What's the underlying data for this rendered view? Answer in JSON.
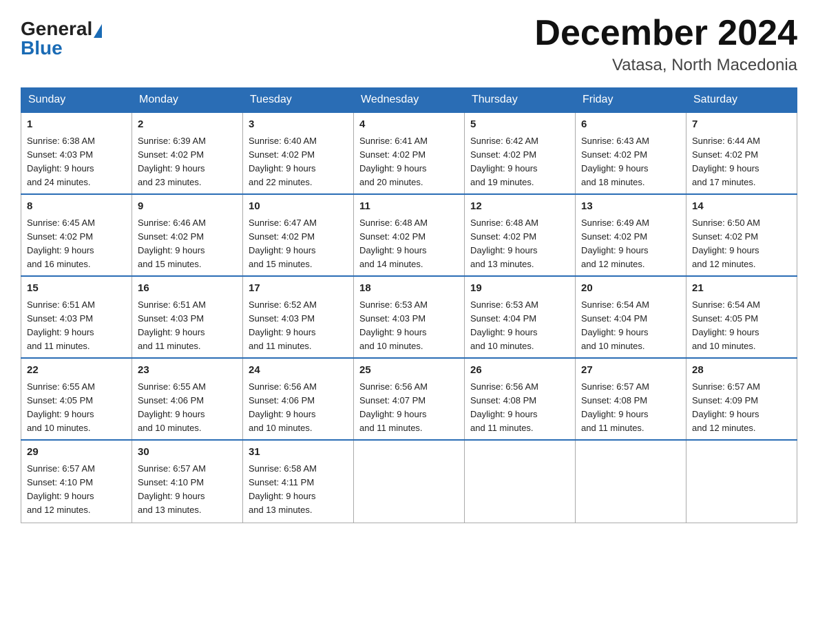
{
  "header": {
    "logo": {
      "general": "General",
      "blue": "Blue"
    },
    "title": "December 2024",
    "location": "Vatasa, North Macedonia"
  },
  "days_of_week": [
    "Sunday",
    "Monday",
    "Tuesday",
    "Wednesday",
    "Thursday",
    "Friday",
    "Saturday"
  ],
  "weeks": [
    [
      {
        "day": "1",
        "sunrise": "6:38 AM",
        "sunset": "4:03 PM",
        "daylight": "9 hours and 24 minutes."
      },
      {
        "day": "2",
        "sunrise": "6:39 AM",
        "sunset": "4:02 PM",
        "daylight": "9 hours and 23 minutes."
      },
      {
        "day": "3",
        "sunrise": "6:40 AM",
        "sunset": "4:02 PM",
        "daylight": "9 hours and 22 minutes."
      },
      {
        "day": "4",
        "sunrise": "6:41 AM",
        "sunset": "4:02 PM",
        "daylight": "9 hours and 20 minutes."
      },
      {
        "day": "5",
        "sunrise": "6:42 AM",
        "sunset": "4:02 PM",
        "daylight": "9 hours and 19 minutes."
      },
      {
        "day": "6",
        "sunrise": "6:43 AM",
        "sunset": "4:02 PM",
        "daylight": "9 hours and 18 minutes."
      },
      {
        "day": "7",
        "sunrise": "6:44 AM",
        "sunset": "4:02 PM",
        "daylight": "9 hours and 17 minutes."
      }
    ],
    [
      {
        "day": "8",
        "sunrise": "6:45 AM",
        "sunset": "4:02 PM",
        "daylight": "9 hours and 16 minutes."
      },
      {
        "day": "9",
        "sunrise": "6:46 AM",
        "sunset": "4:02 PM",
        "daylight": "9 hours and 15 minutes."
      },
      {
        "day": "10",
        "sunrise": "6:47 AM",
        "sunset": "4:02 PM",
        "daylight": "9 hours and 15 minutes."
      },
      {
        "day": "11",
        "sunrise": "6:48 AM",
        "sunset": "4:02 PM",
        "daylight": "9 hours and 14 minutes."
      },
      {
        "day": "12",
        "sunrise": "6:48 AM",
        "sunset": "4:02 PM",
        "daylight": "9 hours and 13 minutes."
      },
      {
        "day": "13",
        "sunrise": "6:49 AM",
        "sunset": "4:02 PM",
        "daylight": "9 hours and 12 minutes."
      },
      {
        "day": "14",
        "sunrise": "6:50 AM",
        "sunset": "4:02 PM",
        "daylight": "9 hours and 12 minutes."
      }
    ],
    [
      {
        "day": "15",
        "sunrise": "6:51 AM",
        "sunset": "4:03 PM",
        "daylight": "9 hours and 11 minutes."
      },
      {
        "day": "16",
        "sunrise": "6:51 AM",
        "sunset": "4:03 PM",
        "daylight": "9 hours and 11 minutes."
      },
      {
        "day": "17",
        "sunrise": "6:52 AM",
        "sunset": "4:03 PM",
        "daylight": "9 hours and 11 minutes."
      },
      {
        "day": "18",
        "sunrise": "6:53 AM",
        "sunset": "4:03 PM",
        "daylight": "9 hours and 10 minutes."
      },
      {
        "day": "19",
        "sunrise": "6:53 AM",
        "sunset": "4:04 PM",
        "daylight": "9 hours and 10 minutes."
      },
      {
        "day": "20",
        "sunrise": "6:54 AM",
        "sunset": "4:04 PM",
        "daylight": "9 hours and 10 minutes."
      },
      {
        "day": "21",
        "sunrise": "6:54 AM",
        "sunset": "4:05 PM",
        "daylight": "9 hours and 10 minutes."
      }
    ],
    [
      {
        "day": "22",
        "sunrise": "6:55 AM",
        "sunset": "4:05 PM",
        "daylight": "9 hours and 10 minutes."
      },
      {
        "day": "23",
        "sunrise": "6:55 AM",
        "sunset": "4:06 PM",
        "daylight": "9 hours and 10 minutes."
      },
      {
        "day": "24",
        "sunrise": "6:56 AM",
        "sunset": "4:06 PM",
        "daylight": "9 hours and 10 minutes."
      },
      {
        "day": "25",
        "sunrise": "6:56 AM",
        "sunset": "4:07 PM",
        "daylight": "9 hours and 11 minutes."
      },
      {
        "day": "26",
        "sunrise": "6:56 AM",
        "sunset": "4:08 PM",
        "daylight": "9 hours and 11 minutes."
      },
      {
        "day": "27",
        "sunrise": "6:57 AM",
        "sunset": "4:08 PM",
        "daylight": "9 hours and 11 minutes."
      },
      {
        "day": "28",
        "sunrise": "6:57 AM",
        "sunset": "4:09 PM",
        "daylight": "9 hours and 12 minutes."
      }
    ],
    [
      {
        "day": "29",
        "sunrise": "6:57 AM",
        "sunset": "4:10 PM",
        "daylight": "9 hours and 12 minutes."
      },
      {
        "day": "30",
        "sunrise": "6:57 AM",
        "sunset": "4:10 PM",
        "daylight": "9 hours and 13 minutes."
      },
      {
        "day": "31",
        "sunrise": "6:58 AM",
        "sunset": "4:11 PM",
        "daylight": "9 hours and 13 minutes."
      },
      null,
      null,
      null,
      null
    ]
  ],
  "labels": {
    "sunrise": "Sunrise:",
    "sunset": "Sunset:",
    "daylight": "Daylight:"
  }
}
